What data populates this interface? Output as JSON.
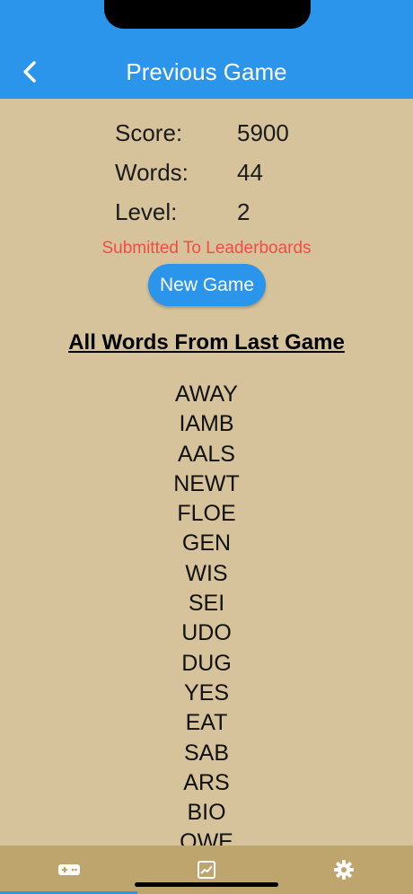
{
  "header": {
    "title": "Previous Game"
  },
  "stats": [
    {
      "label": "Score:",
      "value": "5900"
    },
    {
      "label": "Words:",
      "value": "44"
    },
    {
      "label": "Level:",
      "value": "2"
    }
  ],
  "status_text": "Submitted To Leaderboards",
  "new_game_label": "New Game",
  "words_heading": "All Words From Last Game",
  "words": [
    "AWAY",
    "IAMB",
    "AALS",
    "NEWT",
    "FLOE",
    "GEN",
    "WIS",
    "SEI",
    "UDO",
    "DUG",
    "YES",
    "EAT",
    "SAB",
    "ARS",
    "BIO",
    "OWE"
  ],
  "tabs": [
    {
      "icon": "gamepad-icon"
    },
    {
      "icon": "chart-icon"
    },
    {
      "icon": "gear-icon"
    }
  ],
  "colors": {
    "accent": "#2b95ec",
    "background": "#d6c39b",
    "tabbar": "#bea56e",
    "status": "#f04d45"
  }
}
